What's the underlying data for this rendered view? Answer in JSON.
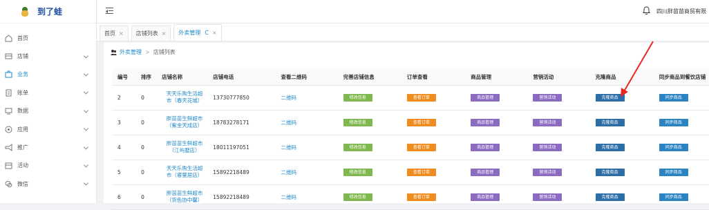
{
  "brand": {
    "name": "到了蛙"
  },
  "sidebar": {
    "items": [
      {
        "label": "首页",
        "icon": "home-icon",
        "has_children": false,
        "active": false
      },
      {
        "label": "店铺",
        "icon": "store-icon",
        "has_children": true,
        "active": false
      },
      {
        "label": "业务",
        "icon": "business-icon",
        "has_children": true,
        "active": true
      },
      {
        "label": "账单",
        "icon": "bill-icon",
        "has_children": true,
        "active": false
      },
      {
        "label": "数据",
        "icon": "data-icon",
        "has_children": true,
        "active": false
      },
      {
        "label": "应用",
        "icon": "apps-icon",
        "has_children": true,
        "active": false
      },
      {
        "label": "推广",
        "icon": "promotion-icon",
        "has_children": true,
        "active": false
      },
      {
        "label": "活动",
        "icon": "activity-icon",
        "has_children": true,
        "active": false
      },
      {
        "label": "微信",
        "icon": "wechat-icon",
        "has_children": true,
        "active": false
      }
    ]
  },
  "header": {
    "company": "四川胖苗苗商贸有限"
  },
  "tabs": [
    {
      "label": "首页",
      "active": false
    },
    {
      "label": "店铺列表",
      "active": false
    },
    {
      "label": "外卖管理",
      "active": true
    }
  ],
  "breadcrumb": {
    "root": "外卖管理",
    "current": "店铺列表"
  },
  "table": {
    "headers": [
      "编号",
      "排序",
      "店铺名称",
      "店铺电话",
      "查看二维码",
      "完善店铺信息",
      "订单查看",
      "商品管理",
      "营销活动",
      "克隆商品",
      "同步商品到餐饮店铺"
    ],
    "qr_label": "二维码",
    "buttons": {
      "edit": "修改信息",
      "orders": "查看订单",
      "products": "商品管理",
      "marketing": "营销活动",
      "clone": "克隆商品",
      "sync": "同步商品"
    },
    "rows": [
      {
        "id": "2",
        "sort": "0",
        "name1": "天天乐购生活超",
        "name2": "市（春天花城）",
        "phone": "13730777850"
      },
      {
        "id": "3",
        "sort": "0",
        "name1": "胖苗苗生鲜超市",
        "name2": "（紫金天成店）",
        "phone": "18783278171"
      },
      {
        "id": "4",
        "sort": "0",
        "name1": "胖苗苗生鲜超市",
        "name2": "（江屿墅店）",
        "phone": "18011197051"
      },
      {
        "id": "5",
        "sort": "0",
        "name1": "天天乐购生活超",
        "name2": "市（睿蓥居店）",
        "phone": "15892218489"
      },
      {
        "id": "6",
        "sort": "0",
        "name1": "胖苗苗生鲜超市",
        "name2": "（货色协中馨）",
        "phone": "15892218489"
      }
    ]
  }
}
